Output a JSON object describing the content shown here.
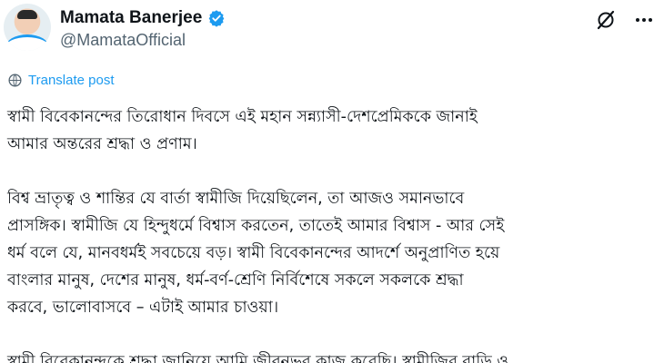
{
  "author": {
    "display_name": "Mamata Banerjee",
    "handle": "@MamataOfficial",
    "verified": true
  },
  "icons": {
    "avatar": "avatar-photo",
    "verified": "verified-badge-icon",
    "grok": "grok-icon",
    "more": "more-options-icon",
    "translate": "translate-icon"
  },
  "colors": {
    "accent": "#1d9bf0",
    "text": "#0f1419",
    "secondary_text": "#536471"
  },
  "translate_label": "Translate post",
  "post": {
    "paragraphs": [
      {
        "lines": [
          "স্বামী বিবেকানন্দের তিরোধান দিবসে এই মহান সন্ন্যাসী-দেশপ্রেমিককে জানাই",
          "আমার অন্তরের শ্রদ্ধা ও প্রণাম।"
        ]
      },
      {
        "lines": [
          "বিশ্ব ভ্রাতৃত্ব ও শান্তির যে বার্তা স্বামীজি দিয়েছিলেন, তা আজও সমানভাবে",
          "প্রাসঙ্গিক। স্বামীজি যে হিন্দুধর্মে বিশ্বাস করতেন, তাতেই আমার বিশ্বাস - আর সেই",
          "ধর্ম বলে যে, মানবধর্মই সবচেয়ে বড়। স্বামী বিবেকানন্দের আদর্শে অনুপ্রাণিত হয়ে",
          "বাংলার মানুষ, দেশের মানুষ, ধর্ম-বর্ণ-শ্রেণি নির্বিশেষে সকলে সকলকে শ্রদ্ধা",
          "করবে, ভালোবাসবে – এটাই আমার চাওয়া।"
        ]
      },
      {
        "lines": [
          "স্বামী বিবেকানন্দকে শ্রদ্ধা জানিয়ে আমি জীবনভর কাজ করেছি। স্বামীজির বাড়ি ও"
        ]
      }
    ]
  }
}
